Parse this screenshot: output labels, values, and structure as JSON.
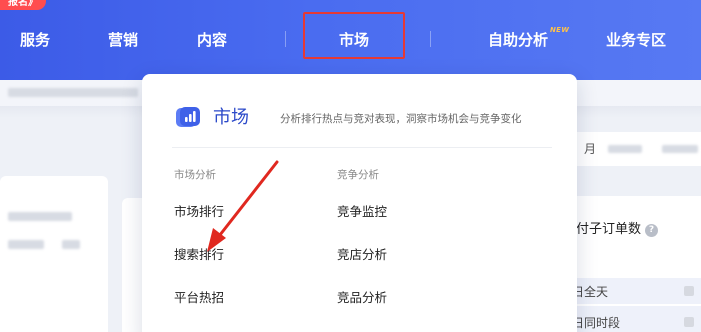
{
  "promo": {
    "label": "报名》"
  },
  "nav": {
    "items": [
      {
        "label": "服务"
      },
      {
        "label": "营销"
      },
      {
        "label": "内容"
      },
      {
        "label": "市场"
      },
      {
        "label": "自助分析"
      },
      {
        "label": "业务专区"
      }
    ],
    "new_badge": "NEW",
    "active_label": "市场"
  },
  "dropdown": {
    "title": "市场",
    "description": "分析排行热点与竞对表现，洞察市场机会与竞争变化",
    "columns": [
      {
        "title": "市场分析",
        "links": [
          "市场排行",
          "搜索排行",
          "平台热招"
        ]
      },
      {
        "title": "竞争分析",
        "links": [
          "竞争监控",
          "竞店分析",
          "竞品分析"
        ]
      }
    ]
  },
  "background": {
    "right_header_char": "月",
    "metric_label": "付子订单数",
    "help_glyph": "?",
    "rows": [
      "日全天",
      "日同时段"
    ]
  },
  "colors": {
    "nav_bg": "#4a6cf0",
    "active_outline": "#e53935",
    "brand_blue": "#2c4ac9",
    "new_badge": "#ffc24a",
    "annotation_arrow": "#e0281f"
  },
  "icons": {
    "dropdown": "market-chart-icon",
    "help": "help-circle-icon",
    "annotation": "annotation-arrow"
  }
}
